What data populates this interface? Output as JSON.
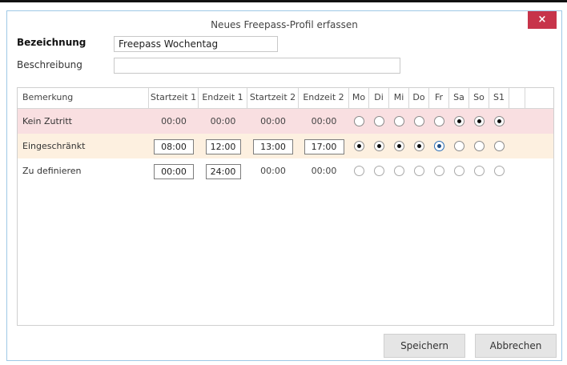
{
  "window": {
    "title": "Neues Freepass-Profil erfassen",
    "close_symbol": "×"
  },
  "form": {
    "bezeichnung_label": "Bezeichnung",
    "bezeichnung_value": "Freepass Wochentag",
    "beschreibung_label": "Beschreibung",
    "beschreibung_value": ""
  },
  "table": {
    "headers": [
      "Bemerkung",
      "Startzeit 1",
      "Endzeit 1",
      "Startzeit 2",
      "Endzeit 2",
      "Mo",
      "Di",
      "Mi",
      "Do",
      "Fr",
      "Sa",
      "So",
      "S1"
    ],
    "rows": [
      {
        "name": "Kein Zutritt",
        "start1": "00:00",
        "end1": "00:00",
        "start2": "00:00",
        "end2": "00:00",
        "days": [
          false,
          false,
          false,
          false,
          false,
          true,
          true,
          true
        ],
        "row_color": "#f9dfe1"
      },
      {
        "name": "Eingeschränkt",
        "start1": "08:00",
        "end1": "12:00",
        "start2": "13:00",
        "end2": "17:00",
        "days": [
          true,
          true,
          true,
          true,
          true,
          false,
          false,
          false
        ],
        "row_color": "#fdf0e0"
      },
      {
        "name": "Zu definieren",
        "start1": "00:00",
        "end1": "24:00",
        "start2": "00:00",
        "end2": "00:00",
        "days": [
          false,
          false,
          false,
          false,
          false,
          false,
          false,
          false
        ],
        "row_color": "#ffffff"
      }
    ]
  },
  "buttons": {
    "save": "Speichern",
    "cancel": "Abbrechen"
  },
  "colors": {
    "close_button": "#c7344a",
    "window_border": "#9ec8e6"
  },
  "icons": {
    "close": "close-icon",
    "radio": "radio-button"
  }
}
